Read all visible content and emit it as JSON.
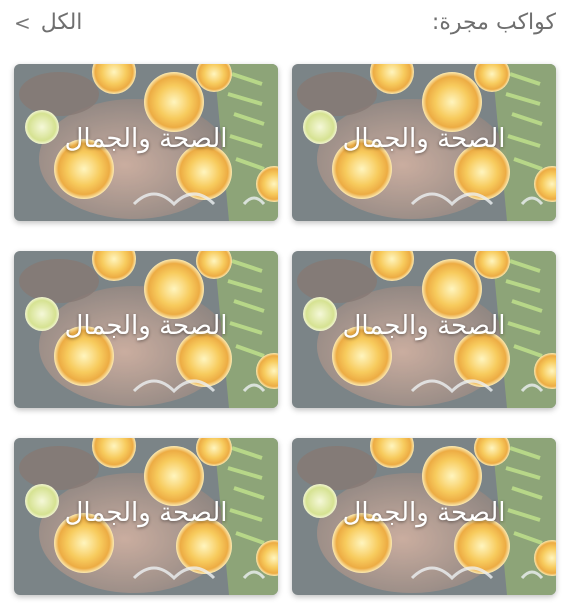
{
  "header": {
    "title": "كواكب مجرة:",
    "view_all_label": "الكل"
  },
  "cards": [
    {
      "label": "الصحة والجمال"
    },
    {
      "label": "الصحة والجمال"
    },
    {
      "label": "الصحة والجمال"
    },
    {
      "label": "الصحة والجمال"
    },
    {
      "label": "الصحة والجمال"
    },
    {
      "label": "الصحة والجمال"
    }
  ],
  "colors": {
    "header_text": "#6f6f6f",
    "card_label": "#ffffff"
  }
}
